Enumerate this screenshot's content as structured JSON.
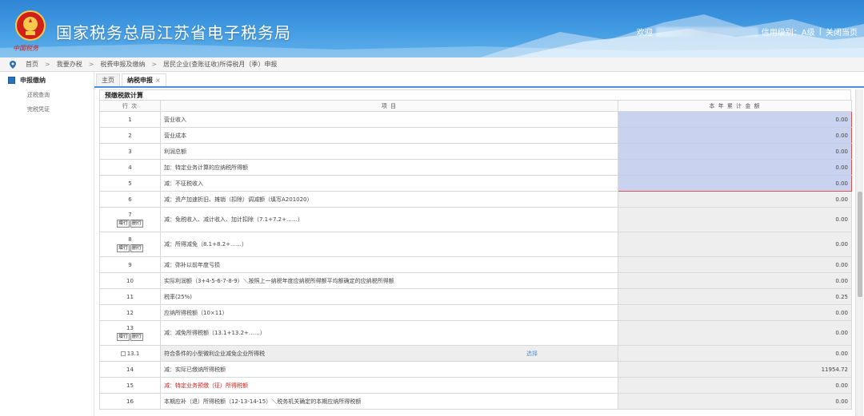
{
  "header": {
    "site_title": "国家税务总局江苏省电子税务局",
    "brand_mark": "中国税务",
    "welcome": "欢迎",
    "credit_label": "信用级别：A级",
    "close_home": "关闭当页",
    "separator": "|"
  },
  "breadcrumb": {
    "items": [
      "首页",
      "我要办税",
      "税费申报及缴纳",
      "居民企业(查账征收)所得税月（季）申报"
    ],
    "separator": ">"
  },
  "sidebar": {
    "section_title": "申报缴纳",
    "items": [
      "还税查询",
      "完税凭证"
    ]
  },
  "tabs": [
    {
      "label": "主页"
    },
    {
      "label": "纳税申报",
      "close": "×"
    }
  ],
  "form": {
    "section_title": "预缴税款计算",
    "columns": {
      "row_no": "行 次",
      "item": "项 目",
      "amount": "本 年 累 计 金 额"
    },
    "add_row": "增行",
    "delete_row": "删行",
    "select_link": "选择",
    "rows": [
      {
        "no": "1",
        "item": "营业收入",
        "amount": "0.00"
      },
      {
        "no": "2",
        "item": "营业成本",
        "amount": "0.00"
      },
      {
        "no": "3",
        "item": "利润总额",
        "amount": "0.00"
      },
      {
        "no": "4",
        "item": "加：特定业务计算的应纳税所得额",
        "amount": "0.00"
      },
      {
        "no": "5",
        "item": "减：不征税收入",
        "amount": "0.00"
      },
      {
        "no": "6",
        "item": "减：资产加速折旧、摊销（扣除）调减额（填写A201020）",
        "amount": "0.00"
      },
      {
        "no": "7",
        "item": "减：免税收入、减计收入、加计扣除（7.1+7.2+……）",
        "amount": "0.00"
      },
      {
        "no": "8",
        "item": "减：所得减免（8.1+8.2+……）",
        "amount": "0.00"
      },
      {
        "no": "9",
        "item": "减：弥补以前年度亏损",
        "amount": "0.00"
      },
      {
        "no": "10",
        "item": "实际利润额（3+4-5-6-7-8-9）＼按照上一纳税年度应纳税所得额平均额确定的应纳税所得额",
        "amount": "0.00"
      },
      {
        "no": "11",
        "item": "税率(25%)",
        "amount": "0.25"
      },
      {
        "no": "12",
        "item": "应纳所得税额（10×11）",
        "amount": "0.00"
      },
      {
        "no": "13",
        "item": "减：减免所得税额（13.1+13.2+……）",
        "amount": "0.00"
      },
      {
        "no": "13.1",
        "item": "符合条件的小型微利企业减免企业所得税",
        "amount": "0.00"
      },
      {
        "no": "14",
        "item": "减：实际已缴纳所得税额",
        "amount": "11954.72"
      },
      {
        "no": "15",
        "item": "减：特定业务预缴（征）所得税额",
        "amount": "0.00"
      },
      {
        "no": "16",
        "item": "本期应补（退）所得税额（12-13-14-15）＼税务机关确定的本期应纳所得税额",
        "amount": "0.00"
      }
    ]
  },
  "colors": {
    "header_blue": "#3f98e0",
    "active_blue_cell": "#c9d3ef",
    "highlight_border": "#d9534f",
    "red_text": "#d0201a"
  }
}
